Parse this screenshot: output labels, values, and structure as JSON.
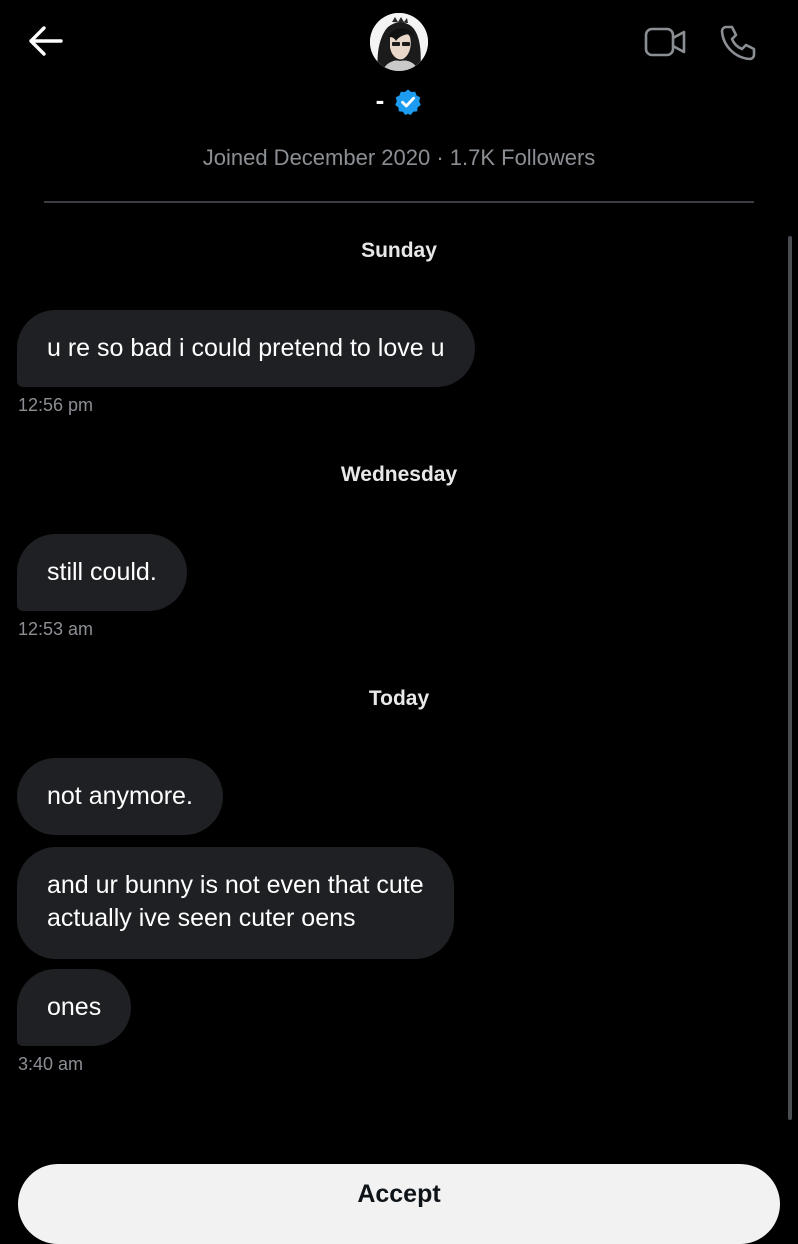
{
  "header": {
    "name": "-",
    "meta": "Joined December 2020 · 1.7K Followers",
    "icons": {
      "back": "arrow-left-icon",
      "video": "video-camera-icon",
      "call": "phone-icon",
      "verified": "verified-badge-icon"
    }
  },
  "conversation": [
    {
      "day": "Sunday",
      "messages": [
        {
          "text": "u re so bad i could pretend to love u"
        }
      ],
      "time": "12:56 pm"
    },
    {
      "day": "Wednesday",
      "messages": [
        {
          "text": "still could."
        }
      ],
      "time": "12:53 am"
    },
    {
      "day": "Today",
      "messages": [
        {
          "text": "not anymore."
        },
        {
          "lines": [
            "and ur bunny is not even that cute",
            "actually ive seen cuter oens"
          ]
        },
        {
          "text": "ones"
        }
      ],
      "time": "3:40 am"
    }
  ],
  "footer": {
    "accept_label": "Accept"
  },
  "colors": {
    "background": "#000000",
    "bubble": "#1f2023",
    "muted_text": "#8b8f94",
    "verified": "#1d9bf0",
    "button_bg": "#f2f2f2"
  }
}
